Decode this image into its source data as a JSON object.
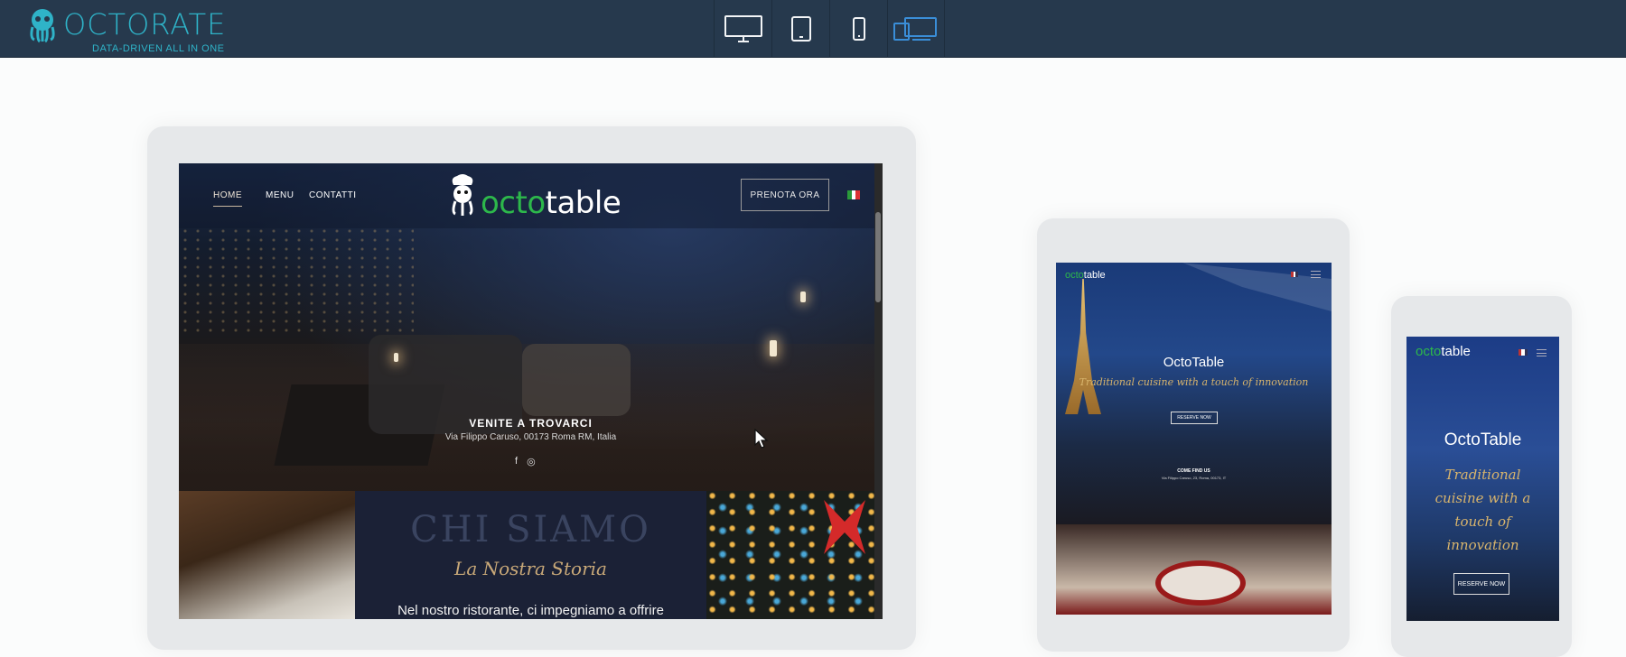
{
  "topbar": {
    "logo_text": "OCTORATE",
    "logo_tagline": "DATA-DRIVEN ALL IN ONE",
    "device_buttons": [
      "desktop-icon",
      "tablet-icon",
      "mobile-icon",
      "responsive-icon"
    ],
    "active_device": "responsive",
    "accent_color": "#3a8ed8",
    "bg_color": "#26394d"
  },
  "desktop": {
    "nav": {
      "home": "HOME",
      "menu": "MENU",
      "contatti": "CONTATTI"
    },
    "brand": {
      "pre": "octo",
      "post": "table"
    },
    "reserve_button": "PRENOTA ORA",
    "find_us": "VENITE A TROVARCI",
    "address": "Via Filippo Caruso, 00173 Roma RM, Italia",
    "chi_siamo": "CHI SIAMO",
    "storia": "La Nostra Storia",
    "body_text": "Nel nostro ristorante, ci impegniamo a offrire"
  },
  "tablet": {
    "brand": {
      "pre": "octo",
      "post": "table"
    },
    "title": "OctoTable",
    "subtitle": "Traditional cuisine with a touch of innovation",
    "reserve": "RESERVE NOW",
    "come_find": "COME FIND US",
    "address": "Via Filippo Caruso, 23, Roma, 00173, IT"
  },
  "mobile": {
    "brand": {
      "pre": "octo",
      "post": "table"
    },
    "title": "OctoTable",
    "subtitle": "Traditional cuisine with a touch of innovation",
    "reserve": "RESERVE NOW"
  }
}
